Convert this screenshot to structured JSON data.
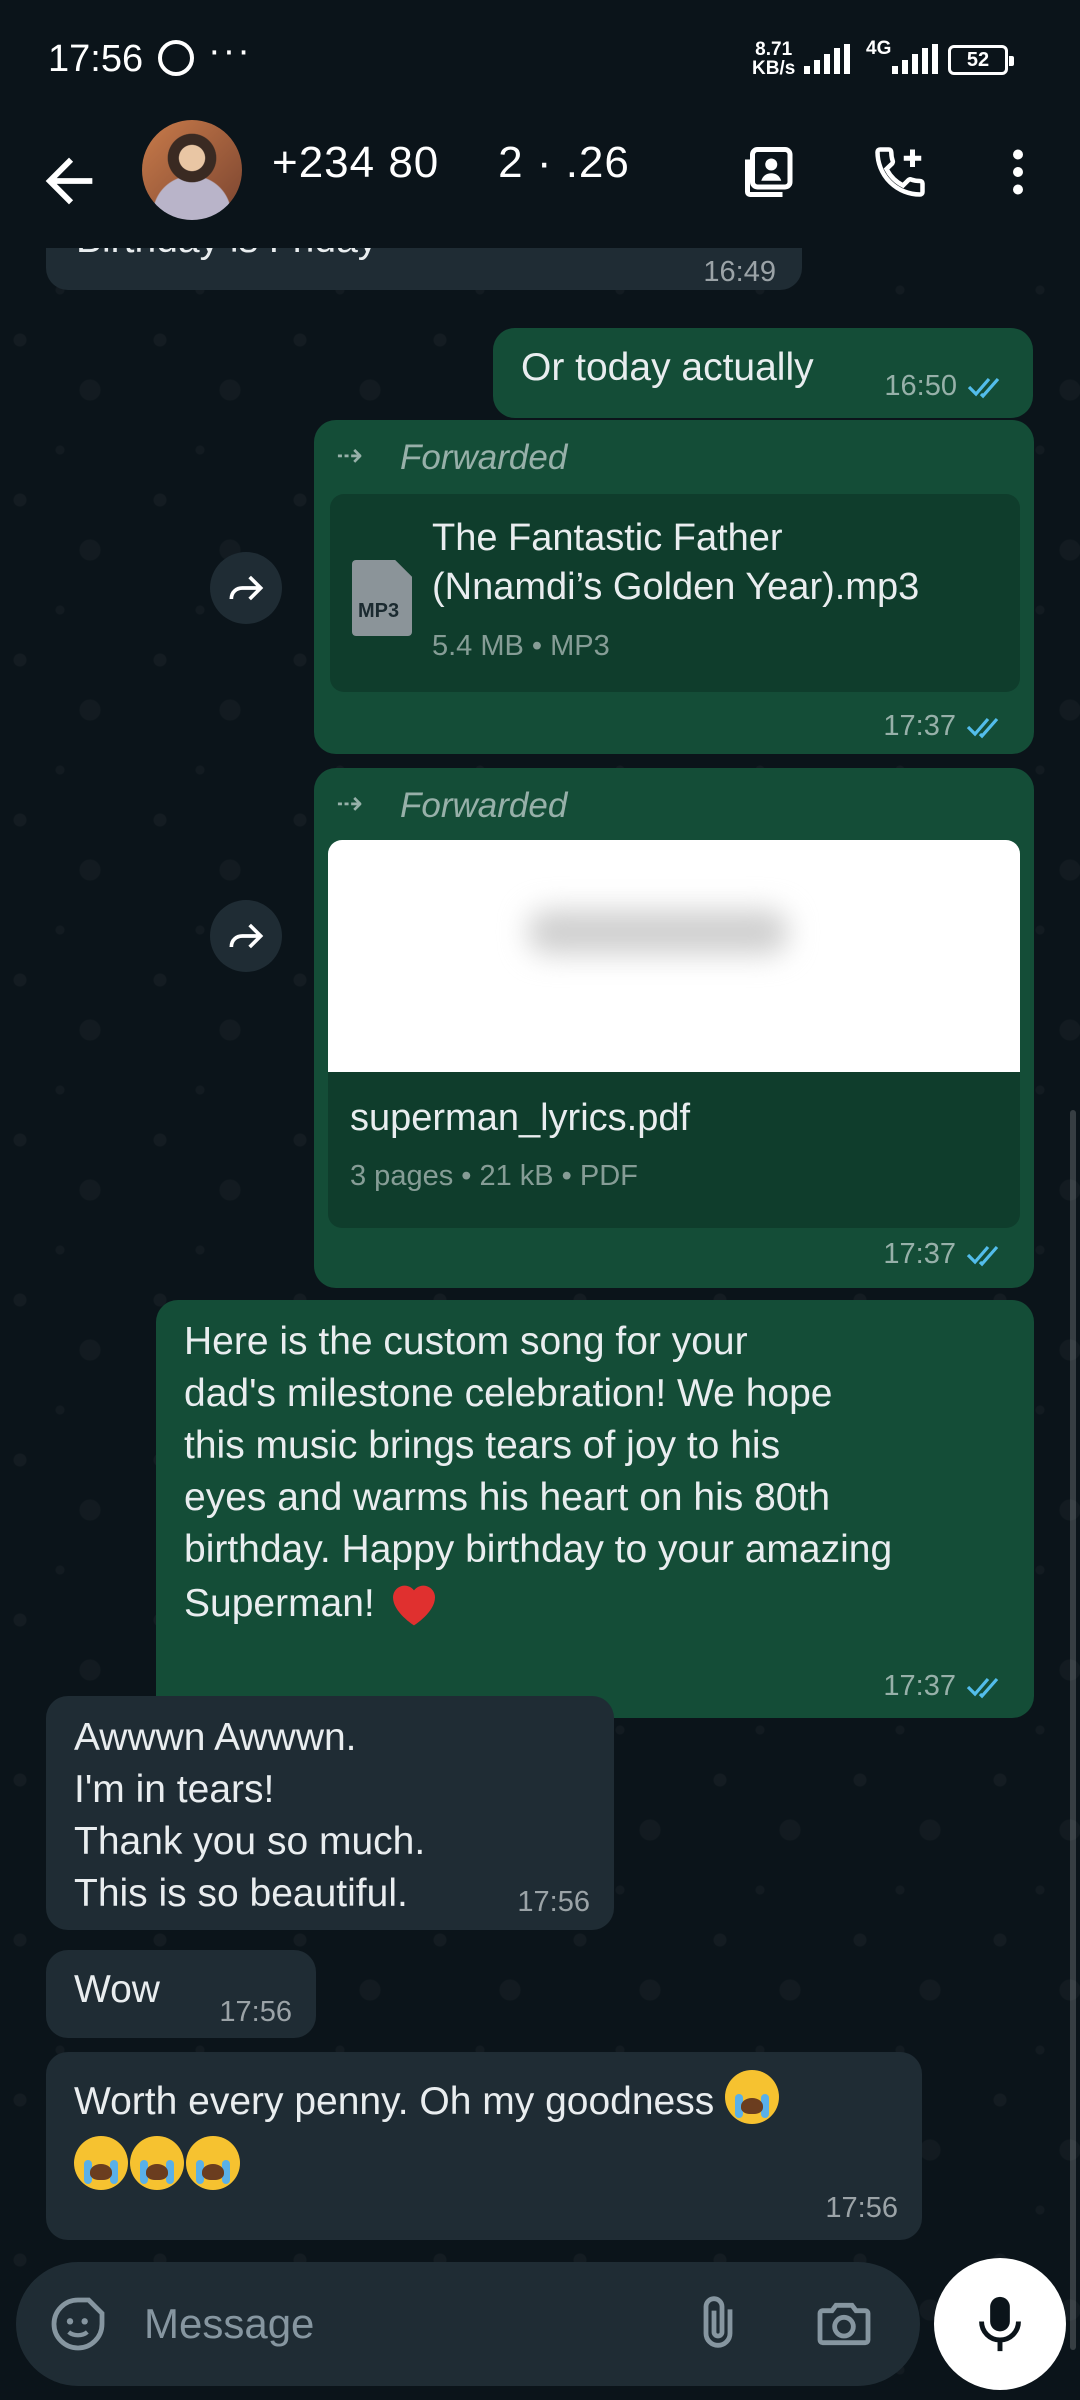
{
  "status_bar": {
    "time": "17:56",
    "more": "···",
    "net_speed_value": "8.71",
    "net_speed_unit": "KB/s",
    "network": "4G",
    "battery": "52"
  },
  "header": {
    "contact": "+234 80      2 · .26"
  },
  "messages": {
    "m0": {
      "text": "Birthday is Friday",
      "time": "16:49"
    },
    "m1": {
      "text": "Or today actually",
      "time": "16:50"
    },
    "m2": {
      "forwarded_label": "Forwarded",
      "file_name_line1": "The Fantastic Father",
      "file_name_line2": "(Nnamdi’s Golden Year).mp3",
      "file_type_badge": "MP3",
      "file_meta": "5.4 MB • MP3",
      "time": "17:37"
    },
    "m3": {
      "forwarded_label": "Forwarded",
      "file_name": "superman_lyrics.pdf",
      "file_meta": "3 pages • 21 kB • PDF",
      "time": "17:37"
    },
    "m4": {
      "line1": "Here is the custom song for your",
      "line2": "dad's milestone celebration! We hope",
      "line3": "this music brings tears of joy to his",
      "line4": "eyes and warms his heart on his 80th",
      "line5": "birthday. Happy birthday to your amazing",
      "line6": "Superman!",
      "time": "17:37"
    },
    "m5": {
      "line1": "Awwwn Awwwn.",
      "line2": "I'm in tears!",
      "line3": "Thank you so much.",
      "line4": "This is so beautiful.",
      "time": "17:56"
    },
    "m6": {
      "text": "Wow",
      "time": "17:56"
    },
    "m7": {
      "text": "Worth every penny. Oh my goodness",
      "time": "17:56"
    }
  },
  "input": {
    "placeholder": "Message"
  },
  "colors": {
    "background": "#0b141a",
    "incoming_bubble": "#1f2c34",
    "outgoing_bubble": "#144d37",
    "read_ticks": "#53bdeb"
  },
  "icons": [
    "back-arrow-icon",
    "contact-card-icon",
    "add-call-icon",
    "more-vert-icon",
    "share-forward-icon",
    "sticker-icon",
    "attach-icon",
    "camera-icon",
    "mic-icon"
  ]
}
